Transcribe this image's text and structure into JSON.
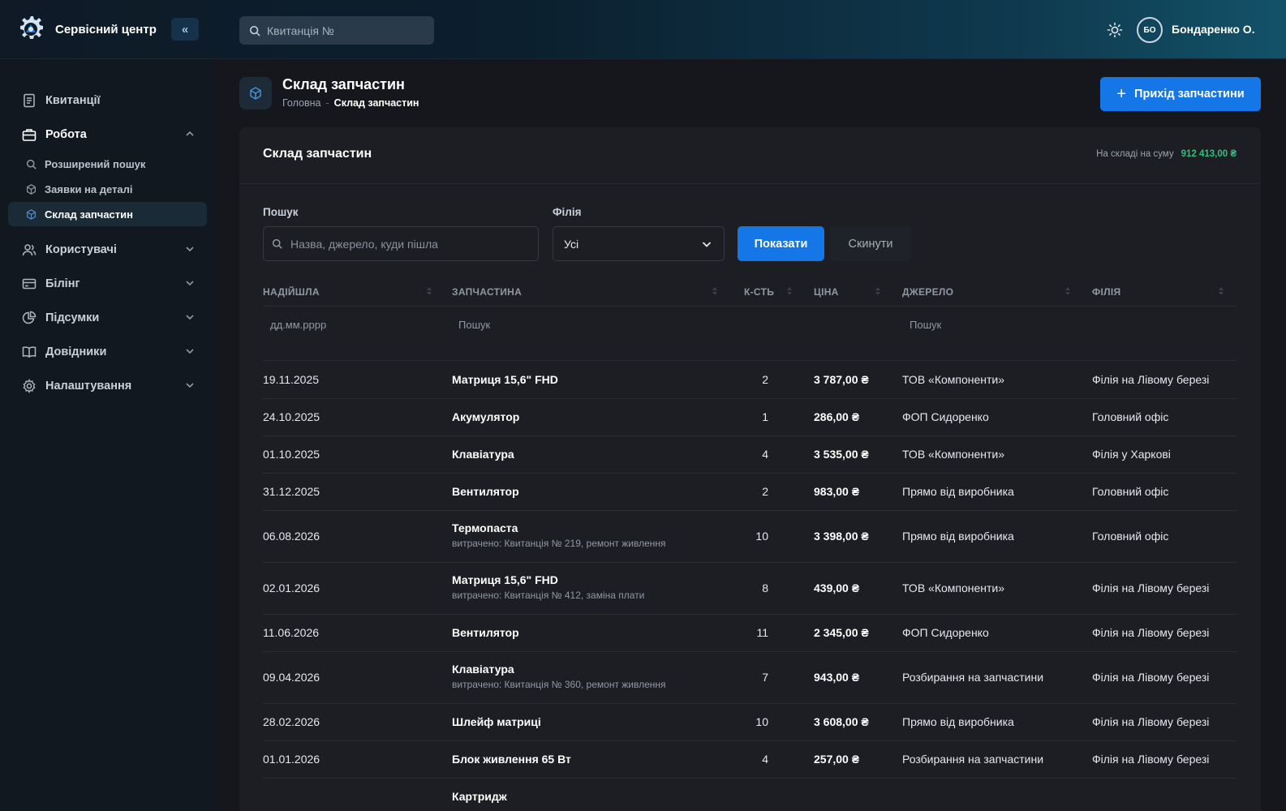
{
  "app": {
    "title": "Сервісний центр",
    "collapse_icon": "«"
  },
  "topbar": {
    "search_placeholder": "Квитанція №",
    "user_initials": "БО",
    "user_name": "Бондаренко О."
  },
  "sidebar": {
    "items": [
      {
        "label": "Квитанції",
        "icon": "receipt-icon"
      },
      {
        "label": "Робота",
        "icon": "briefcase-icon",
        "expanded": true
      },
      {
        "label": "Користувачі",
        "icon": "users-icon"
      },
      {
        "label": "Білінг",
        "icon": "credit-card-icon"
      },
      {
        "label": "Підсумки",
        "icon": "pie-chart-icon"
      },
      {
        "label": "Довідники",
        "icon": "book-icon"
      },
      {
        "label": "Налаштування",
        "icon": "gear-icon"
      }
    ],
    "work_sub": [
      {
        "label": "Розширений пошук",
        "icon": "search-icon"
      },
      {
        "label": "Заявки на деталі",
        "icon": "box-icon"
      },
      {
        "label": "Склад запчастин",
        "icon": "box-icon",
        "selected": true
      }
    ]
  },
  "page": {
    "title": "Склад запчастин",
    "breadcrumb": {
      "home": "Головна",
      "sep": "-",
      "current": "Склад запчастин"
    },
    "add_button": "Прихід запчастини",
    "add_plus": "+"
  },
  "card": {
    "title": "Склад запчастин",
    "stock_label": "На складі на суму",
    "stock_value": "912 413,00 ₴",
    "filters": {
      "search_label": "Пошук",
      "search_placeholder": "Назва, джерело, куди пішла",
      "branch_label": "Філія",
      "branch_value": "Усі",
      "show_button": "Показати",
      "reset_button": "Скинути"
    },
    "table": {
      "headers": [
        "НАДІЙШЛА",
        "ЗАПЧАСТИНА",
        "К-СТЬ",
        "ЦІНА",
        "ДЖЕРЕЛО",
        "ФІЛІЯ"
      ],
      "col_filters": {
        "date": "дд.мм.рррр",
        "part": "Пошук",
        "source": "Пошук"
      },
      "rows": [
        {
          "date": "19.11.2025",
          "part": "Матриця 15,6\" FHD",
          "note": "",
          "qty": "2",
          "price": "3 787,00 ₴",
          "source": "ТОВ «Компоненти»",
          "branch": "Філія на Лівому березі"
        },
        {
          "date": "24.10.2025",
          "part": "Акумулятор",
          "note": "",
          "qty": "1",
          "price": "286,00 ₴",
          "source": "ФОП Сидоренко",
          "branch": "Головний офіс"
        },
        {
          "date": "01.10.2025",
          "part": "Клавіатура",
          "note": "",
          "qty": "4",
          "price": "3 535,00 ₴",
          "source": "ТОВ «Компоненти»",
          "branch": "Філія у Харкові"
        },
        {
          "date": "31.12.2025",
          "part": "Вентилятор",
          "note": "",
          "qty": "2",
          "price": "983,00 ₴",
          "source": "Прямо від виробника",
          "branch": "Головний офіс"
        },
        {
          "date": "06.08.2026",
          "part": "Термопаста",
          "note": "витрачено: Квитанція № 219, ремонт живлення",
          "qty": "10",
          "price": "3 398,00 ₴",
          "source": "Прямо від виробника",
          "branch": "Головний офіс"
        },
        {
          "date": "02.01.2026",
          "part": "Матриця 15,6\" FHD",
          "note": "витрачено: Квитанція № 412, заміна плати",
          "qty": "8",
          "price": "439,00 ₴",
          "source": "ТОВ «Компоненти»",
          "branch": "Філія на Лівому березі"
        },
        {
          "date": "11.06.2026",
          "part": "Вентилятор",
          "note": "",
          "qty": "11",
          "price": "2 345,00 ₴",
          "source": "ФОП Сидоренко",
          "branch": "Філія на Лівому березі"
        },
        {
          "date": "09.04.2026",
          "part": "Клавіатура",
          "note": "витрачено: Квитанція № 360, ремонт живлення",
          "qty": "7",
          "price": "943,00 ₴",
          "source": "Розбирання на запчастини",
          "branch": "Філія на Лівому березі"
        },
        {
          "date": "28.02.2026",
          "part": "Шлейф матриці",
          "note": "",
          "qty": "10",
          "price": "3 608,00 ₴",
          "source": "Прямо від виробника",
          "branch": "Філія на Лівому березі"
        },
        {
          "date": "01.01.2026",
          "part": "Блок живлення 65 Вт",
          "note": "",
          "qty": "4",
          "price": "257,00 ₴",
          "source": "Розбирання на запчастини",
          "branch": "Філія на Лівому березі"
        },
        {
          "date": "",
          "part": "Картридж",
          "note": "",
          "qty": "",
          "price": "",
          "source": "",
          "branch": ""
        }
      ]
    }
  },
  "colors": {
    "accent": "#1576e8",
    "sum_green": "#2ec27e"
  }
}
